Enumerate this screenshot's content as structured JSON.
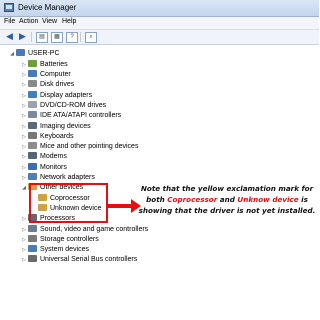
{
  "window": {
    "title": "Device Manager"
  },
  "menu": [
    "File",
    "Action",
    "View",
    "Help"
  ],
  "toolbar": {
    "back": "◀",
    "forward": "▶"
  },
  "tree": {
    "root": "USER-PC",
    "items": [
      {
        "label": "Batteries",
        "icon": "battery-icon",
        "color": "#6f9e3c"
      },
      {
        "label": "Computer",
        "icon": "computer-icon",
        "color": "#4a78b8"
      },
      {
        "label": "Disk drives",
        "icon": "disk-drive-icon",
        "color": "#8a8a8a"
      },
      {
        "label": "Display adapters",
        "icon": "display-adapter-icon",
        "color": "#3f7fc4"
      },
      {
        "label": "DVD/CD-ROM drives",
        "icon": "dvd-drive-icon",
        "color": "#9aa3ad"
      },
      {
        "label": "IDE ATA/ATAPI controllers",
        "icon": "ide-controller-icon",
        "color": "#7a8b9c"
      },
      {
        "label": "Imaging devices",
        "icon": "camera-icon",
        "color": "#5a6a7a"
      },
      {
        "label": "Keyboards",
        "icon": "keyboard-icon",
        "color": "#777777"
      },
      {
        "label": "Mice and other pointing devices",
        "icon": "mouse-icon",
        "color": "#8d8d8d"
      },
      {
        "label": "Modems",
        "icon": "modem-icon",
        "color": "#556677"
      },
      {
        "label": "Monitors",
        "icon": "monitor-icon",
        "color": "#3b6fb0"
      },
      {
        "label": "Network adapters",
        "icon": "network-adapter-icon",
        "color": "#4d7fb5"
      },
      {
        "label": "Other devices",
        "icon": "other-devices-icon",
        "color": "#c9a24a",
        "expanded": true,
        "children": [
          {
            "label": "Coprocessor",
            "icon": "unknown-device-warning-icon"
          },
          {
            "label": "Unknown device",
            "icon": "unknown-device-warning-icon"
          }
        ]
      },
      {
        "label": "Processors",
        "icon": "processor-icon",
        "color": "#5c6b7a"
      },
      {
        "label": "Sound, video and game controllers",
        "icon": "sound-icon",
        "color": "#6c7d8e"
      },
      {
        "label": "Storage controllers",
        "icon": "storage-controller-icon",
        "color": "#7b7b7b"
      },
      {
        "label": "System devices",
        "icon": "system-devices-icon",
        "color": "#4c7cb4"
      },
      {
        "label": "Universal Serial Bus controllers",
        "icon": "usb-icon",
        "color": "#6a6a6a"
      }
    ]
  },
  "annotation": {
    "part1": "Note that the yellow exclamation mark for both ",
    "coprocessor": "Coprocessor",
    "part2": " and ",
    "unknown": "Unknow device",
    "part3": " is showing that the driver is not yet installed.",
    "highlight_color": "#e31010"
  }
}
